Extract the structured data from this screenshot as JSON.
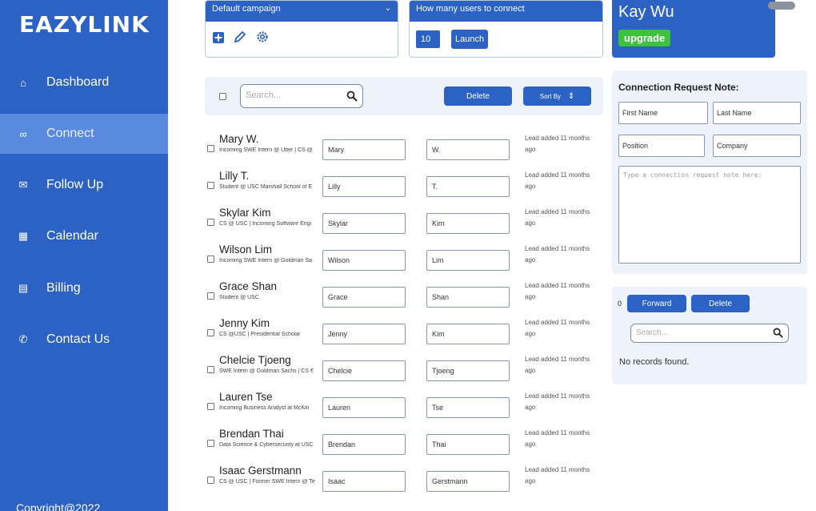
{
  "brand": "EAZYLINK",
  "nav": [
    {
      "label": "Dashboard",
      "icon": "home-icon",
      "glyph": "⌂",
      "active": false
    },
    {
      "label": "Connect",
      "icon": "link-icon",
      "glyph": "∞",
      "active": true
    },
    {
      "label": "Follow Up",
      "icon": "mail-icon",
      "glyph": "✉",
      "active": false
    },
    {
      "label": "Calendar",
      "icon": "calendar-icon",
      "glyph": "▦",
      "active": false
    },
    {
      "label": "Billing",
      "icon": "receipt-icon",
      "glyph": "▤",
      "active": false
    },
    {
      "label": "Contact Us",
      "icon": "phone-icon",
      "glyph": "✆",
      "active": false
    }
  ],
  "copyright": "Copyright@2022",
  "campaign": {
    "selected": "Default campaign",
    "chevron": "⌄",
    "icons": [
      "plus-square-icon",
      "pencil-icon",
      "gear-icon"
    ]
  },
  "connect": {
    "title": "How many users to connect",
    "count": "10",
    "launch_label": "Launch"
  },
  "profile": {
    "name": "Kay Wu",
    "upgrade_label": "upgrade"
  },
  "toolbar": {
    "search_placeholder": "Search...",
    "delete_label": "Delete",
    "sort_label": "Sort By",
    "sort_glyph": "⇕"
  },
  "rows": [
    {
      "name": "Mary W.",
      "headline": "Incoming SWE Intern @ Uber | CS @",
      "first": "Mary",
      "last": "W.",
      "added": "Lead added 11 months ago"
    },
    {
      "name": "Lilly T.",
      "headline": "Student @ USC Marshall School of E",
      "first": "Lilly",
      "last": "T.",
      "added": "Lead added 11 months ago"
    },
    {
      "name": "Skylar Kim",
      "headline": "CS @ USC | Incoming Software Engi",
      "first": "Skylar",
      "last": "Kim",
      "added": "Lead added 11 months ago"
    },
    {
      "name": "Wilson Lim",
      "headline": "Incoming SWE Intern @ Goldman Sa",
      "first": "Wilson",
      "last": "Lim",
      "added": "Lead added 11 months ago"
    },
    {
      "name": "Grace Shan",
      "headline": "Student @ USC",
      "first": "Grace",
      "last": "Shan",
      "added": "Lead added 11 months ago"
    },
    {
      "name": "Jenny Kim",
      "headline": "CS @USC | Presidential Scholar",
      "first": "Jenny",
      "last": "Kim",
      "added": "Lead added 11 months ago"
    },
    {
      "name": "Chelcie Tjoeng",
      "headline": "SWE Intern @ Goldman Sachs | CS €",
      "first": "Chelcie",
      "last": "Tjoeng",
      "added": "Lead added 11 months ago"
    },
    {
      "name": "Lauren Tse",
      "headline": "Incoming Business Analyst at McKin",
      "first": "Lauren",
      "last": "Tse",
      "added": "Lead added 11 months ago"
    },
    {
      "name": "Brendan Thai",
      "headline": "Data Science & Cybersecurity at USC",
      "first": "Brendan",
      "last": "Thai",
      "added": "Lead added 11 months ago"
    },
    {
      "name": "Isaac Gerstmann",
      "headline": "CS @ USC | Former SWE Intern @ Te",
      "first": "Isaac",
      "last": "Gerstmann",
      "added": "Lead added 11 months ago"
    }
  ],
  "note": {
    "title": "Connection Request Note:",
    "first_name": "First Name",
    "last_name": "Last Name",
    "position": "Position",
    "company": "Company",
    "placeholder": "Type a connection request note here:"
  },
  "forward": {
    "count": "0",
    "forward_label": "Forward",
    "delete_label": "Delete",
    "search_placeholder": "Search...",
    "empty": "No records found."
  },
  "colors": {
    "primary": "#2b62c4",
    "active_nav": "#5a8ae0",
    "upgrade": "#3cc23c",
    "panel_bg": "#eef3fb"
  }
}
